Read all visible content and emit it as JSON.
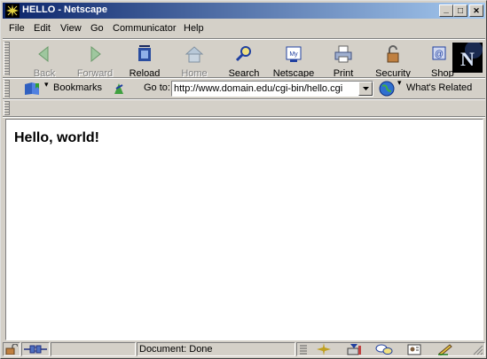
{
  "window": {
    "title": "HELLO - Netscape",
    "controls": {
      "minimize": "_",
      "maximize": "□",
      "close": "✕"
    }
  },
  "menu": [
    "File",
    "Edit",
    "View",
    "Go",
    "Communicator",
    "Help"
  ],
  "toolbar": {
    "buttons": [
      {
        "label": "Back",
        "icon": "back-arrow-icon",
        "enabled": false
      },
      {
        "label": "Forward",
        "icon": "forward-arrow-icon",
        "enabled": false
      },
      {
        "label": "Reload",
        "icon": "reload-icon",
        "enabled": true
      },
      {
        "label": "Home",
        "icon": "home-icon",
        "enabled": false
      },
      {
        "label": "Search",
        "icon": "search-icon",
        "enabled": true
      },
      {
        "label": "Netscape",
        "icon": "my-netscape-icon",
        "enabled": true
      },
      {
        "label": "Print",
        "icon": "print-icon",
        "enabled": true
      },
      {
        "label": "Security",
        "icon": "security-lock-icon",
        "enabled": true
      },
      {
        "label": "Shop",
        "icon": "shop-icon",
        "enabled": true
      }
    ],
    "logo_letter": "N"
  },
  "location": {
    "bookmarks_label": "Bookmarks",
    "goto_label": "Go to:",
    "url": "http://www.domain.edu/cgi-bin/hello.cgi",
    "related_label": "What's Related"
  },
  "content": {
    "heading": "Hello, world!"
  },
  "status": {
    "text": "Document: Done"
  }
}
